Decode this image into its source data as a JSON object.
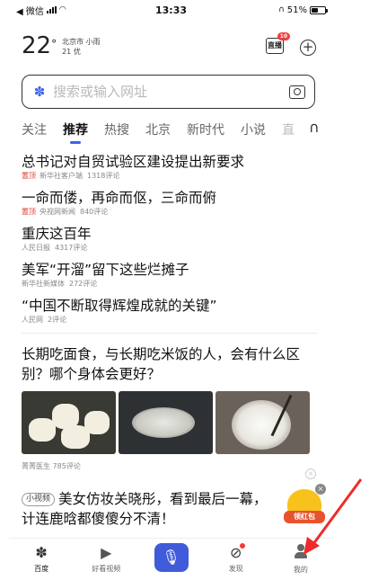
{
  "status_bar": {
    "carrier": "◀ 微信",
    "time": "13:33",
    "battery": "51%"
  },
  "weather": {
    "temperature": "22",
    "degree": "°",
    "location_weather": "北京市 小雨",
    "aqi": "21 优"
  },
  "header": {
    "live_label": "直播",
    "live_badge": "10",
    "plus_icon": "plus-circle-icon"
  },
  "search": {
    "placeholder": "搜索或输入网址",
    "icon": "baidu-paw-icon",
    "camera_icon": "camera-icon"
  },
  "tabs": [
    {
      "label": "关注",
      "active": false
    },
    {
      "label": "推荐",
      "active": true
    },
    {
      "label": "热搜",
      "active": false
    },
    {
      "label": "北京",
      "active": false
    },
    {
      "label": "新时代",
      "active": false
    },
    {
      "label": "小说",
      "active": false
    },
    {
      "label": "直",
      "active": false
    }
  ],
  "news": [
    {
      "title": "总书记对自贸试验区建设提出新要求",
      "tag": "置顶",
      "source": "新华社客户端",
      "comments": "1318评论"
    },
    {
      "title": "一命而偻，再命而伛，三命而俯",
      "tag": "置顶",
      "source": "央视网新闻",
      "comments": "840评论"
    },
    {
      "title": "重庆这百年",
      "tag": "",
      "source": "人民日报",
      "comments": "4317评论"
    },
    {
      "title": "美军“开溜”留下这些烂摊子",
      "tag": "",
      "source": "新华社新媒体",
      "comments": "272评论"
    },
    {
      "title": "“中国不断取得辉煌成就的关键”",
      "tag": "",
      "source": "人民网",
      "comments": "2评论"
    }
  ],
  "feature": {
    "title": "长期吃面食，与长期吃米饭的人，会有什么区别？哪个身体会更好？",
    "source": "菁菁医生",
    "comments": "785评论"
  },
  "video": {
    "tag": "小视频",
    "title": "美女仿妆关晓彤，看到最后一幕，计连鹿晗都傻傻分不清！"
  },
  "red_packet": {
    "label": "领红包",
    "close": "×"
  },
  "bottom_nav": [
    {
      "label": "百度",
      "icon": "baidu-paw-icon",
      "active": true
    },
    {
      "label": "好看视频",
      "icon": "play-icon",
      "active": false
    },
    {
      "label": "",
      "icon": "microphone-icon",
      "active": false
    },
    {
      "label": "发现",
      "icon": "compass-icon",
      "active": false
    },
    {
      "label": "我的",
      "icon": "person-icon",
      "active": false
    }
  ],
  "colors": {
    "accent": "#3a64e8",
    "top_tag": "#e03b2f",
    "mic_button": "#3f5bd9",
    "annotation_arrow": "#ee2a2a"
  }
}
